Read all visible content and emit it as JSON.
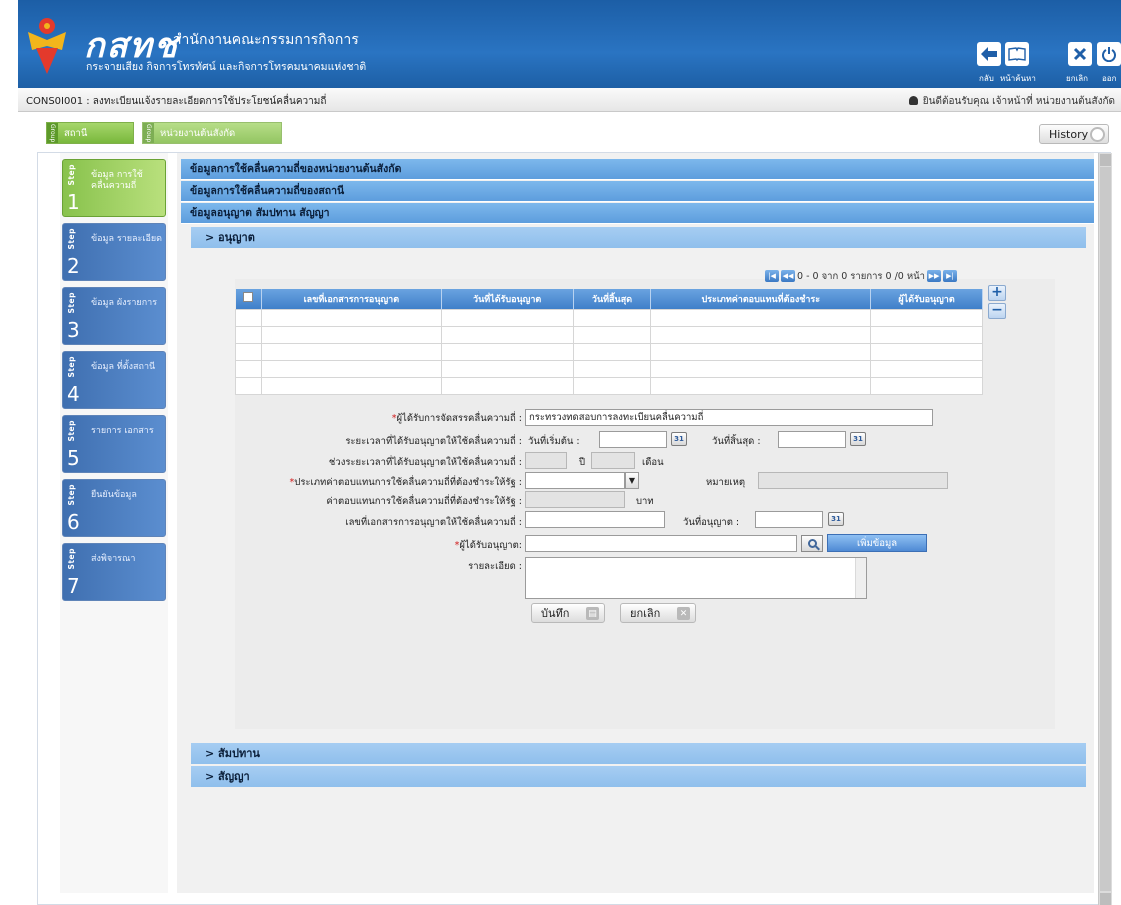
{
  "header": {
    "brand": "กสทช",
    "org_name": "สำนักงานคณะกรรมการกิจการ",
    "org_sub": "กระจายเสียง กิจการโทรทัศน์ และกิจการโทรคมนาคมแห่งชาติ",
    "buttons": [
      {
        "label": "กลับ",
        "icon": "back-arrow-icon",
        "color": "#1f5fa8"
      },
      {
        "label": "หน้าค้นหา",
        "icon": "book-icon",
        "color": "#1f5fa8"
      },
      {
        "label": "ยกเลิก",
        "icon": "close-icon",
        "color": "#1f5fa8"
      },
      {
        "label": "ออก",
        "icon": "power-icon",
        "color": "#1f5fa8"
      }
    ]
  },
  "infobar": {
    "screen_title": "CONS0I001 : ลงทะเบียนแจ้งรายละเอียดการใช้ประโยชน์คลื่นความถี่",
    "welcome": "ยินดีต้อนรับคุณ เจ้าหน้าที่ หน่วยงานต้นสังกัด"
  },
  "tabs": {
    "group_tag": "Group",
    "items": [
      {
        "label": "สถานี"
      },
      {
        "label": "หน่วยงานต้นสังกัด"
      }
    ],
    "history": "History"
  },
  "steps": [
    {
      "tag": "Step",
      "num": "1",
      "label": "ข้อมูล การใช้ คลื่นความถี่",
      "active": true
    },
    {
      "tag": "Step",
      "num": "2",
      "label": "ข้อมูล รายละเอียด",
      "active": false
    },
    {
      "tag": "Step",
      "num": "3",
      "label": "ข้อมูล ผังรายการ",
      "active": false
    },
    {
      "tag": "Step",
      "num": "4",
      "label": "ข้อมูล ที่ตั้งสถานี",
      "active": false
    },
    {
      "tag": "Step",
      "num": "5",
      "label": "รายการ เอกสาร",
      "active": false
    },
    {
      "tag": "Step",
      "num": "6",
      "label": "ยืนยันข้อมูล",
      "active": false
    },
    {
      "tag": "Step",
      "num": "7",
      "label": "ส่งพิจารณา",
      "active": false
    }
  ],
  "sections": {
    "s1": "ข้อมูลการใช้คลื่นความถี่ของหน่วยงานต้นสังกัด",
    "s2": "ข้อมูลการใช้คลื่นความถี่ของสถานี",
    "s3": "ข้อมูลอนุญาต สัมปทาน สัญญา",
    "license": "> อนุญาต",
    "concession": "> สัมปทาน",
    "contract": "> สัญญา"
  },
  "pager": {
    "text": "0 - 0 จาก 0 รายการ  0  /0 หน้า"
  },
  "grid": {
    "columns": [
      "เลขที่เอกสารการอนุญาต",
      "วันที่ได้รับอนุญาต",
      "วันที่สิ้นสุด",
      "ประเภทค่าตอบแทนที่ต้องชำระ",
      "ผู้ได้รับอนุญาต"
    ],
    "empty_rows": 5
  },
  "form": {
    "allocatee_label": "ผู้ได้รับการจัดสรรคลื่นความถี่ :",
    "allocatee_value": "กระทรวงทดสอบการลงทะเบียนคลื่นความถี่",
    "period_label": "ระยะเวลาที่ได้รับอนุญาตให้ใช้คลื่นความถี่ :",
    "start_label": "วันที่เริ่มต้น :",
    "end_label": "วันที่สิ้นสุด :",
    "range_label": "ช่วงระยะเวลาที่ได้รับอนุญาตให้ใช้คลื่นความถี่ :",
    "year_unit": "ปี",
    "month_unit": "เดือน",
    "fee_type_label": "ประเภทค่าตอบแทนการใช้คลื่นความถี่ที่ต้องชำระให้รัฐ :",
    "remark_label": "หมายเหตุ",
    "fee_label": "ค่าตอบแทนการใช้คลื่นความถี่ที่ต้องชำระให้รัฐ :",
    "baht_unit": "บาท",
    "doc_no_label": "เลขที่เอกสารการอนุญาตให้ใช้คลื่นความถี่ :",
    "license_date_label": "วันที่อนุญาต :",
    "licensee_label": "ผู้ได้รับอนุญาต:",
    "add_data": "เพิ่มข้อมูล",
    "detail_label": "รายละเอียด :",
    "save": "บันทึก",
    "cancel": "ยกเลิก",
    "calendar_icon_text": "31"
  }
}
